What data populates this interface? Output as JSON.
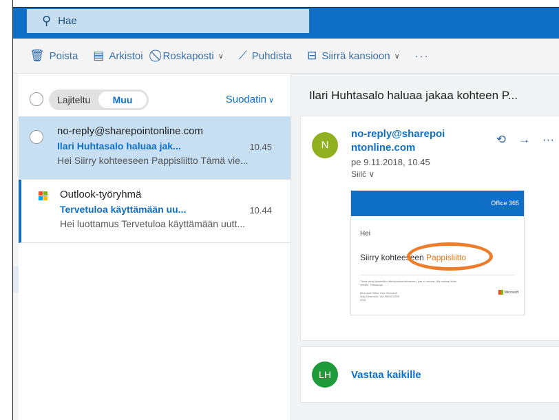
{
  "search": {
    "placeholder": "Hae"
  },
  "toolbar": {
    "delete": "Poista",
    "archive": "Arkistoi",
    "junk": "Roskaposti",
    "sweep": "Puhdista",
    "move": "Siirrä kansioon",
    "more": "···"
  },
  "list": {
    "tab_focused": "Lajiteltu",
    "tab_other": "Muu",
    "filter": "Suodatin",
    "messages": [
      {
        "sender": "no-reply@sharepointonline.com",
        "subject": "Ilari Huhtasalo haluaa jak...",
        "time": "10.45",
        "preview": "Hei Siirry kohteeseen Pappisliitto Tämä vie..."
      },
      {
        "sender": "Outlook-työryhmä",
        "subject": "Tervetuloa käyttämään uu...",
        "time": "10.44",
        "preview": "Hei luottamus Tervetuloa käyttämään uutt..."
      }
    ]
  },
  "reading": {
    "title": "Ilari Huhtasalo haluaa jakaa kohteen P...",
    "avatar": "N",
    "from_line1": "no-reply@sharepoi",
    "from_line2": "ntonline.com",
    "date": "pe 9.11.2018, 10.45",
    "to": "Siilč",
    "embed": {
      "brand": "Office 365",
      "greeting": "Hei",
      "link_prefix": "Siirry kohteeseen ",
      "link_text": "Pappisliitto",
      "footer1": "Tämä viesti lähetettiin sähköpostiosoitteeseen, jota ei valvota. Älä vastaa tähän viestiin. Tietosuoja",
      "footer2": "Microsoft Office One Microsoft Way Redmond, WA 98052-6399 USA",
      "ms": "Microsoft"
    },
    "reply_avatar": "LH",
    "reply_all": "Vastaa kaikille"
  },
  "colors": {
    "accent": "#0f6fc6",
    "selected": "#c7dff3",
    "highlight": "#ee7d2b"
  }
}
